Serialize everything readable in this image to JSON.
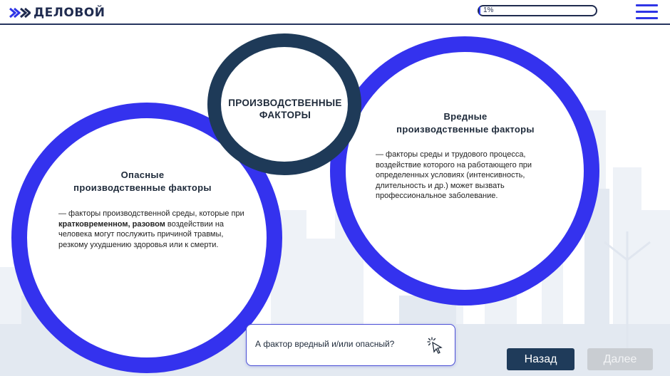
{
  "header": {
    "logo_text": "ДЕЛОВОЙ",
    "progress_label": "1%",
    "progress_value": 0.01
  },
  "circles": {
    "center": {
      "title_line1": "ПРОИЗВОДСТВЕННЫЕ",
      "title_line2": "ФАКТОРЫ"
    },
    "left": {
      "title_line1": "Опасные",
      "title_line2": "производственные факторы",
      "desc_pre": "— факторы производственной среды, которые при ",
      "desc_bold": "кратковременном, разовом",
      "desc_post": " воздействии на человека могут послужить причиной травмы, резкому ухудшению здоровья или к смерти."
    },
    "right": {
      "title_line1": "Вредные",
      "title_line2": "производственные факторы",
      "desc": "— факторы среды и трудового процесса, воздействие которого на работающего при определенных условиях (интенсивность, длительность и др.) может вызвать профессиональное заболевание."
    }
  },
  "question": {
    "text": "А фактор вредный и/или опасный?",
    "icon": "pointer-click-icon"
  },
  "nav": {
    "back_label": "Назад",
    "next_label": "Далее"
  },
  "colors": {
    "accent_blue": "#3432ee",
    "navy": "#1e3a58",
    "disabled": "#c9cdd2"
  }
}
